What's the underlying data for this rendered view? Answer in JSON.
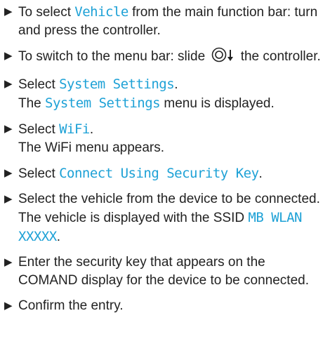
{
  "steps": [
    {
      "pre": "To select ",
      "term": "Vehicle",
      "post": " from the main function bar: turn and press the controller."
    },
    {
      "pre": "To switch to the menu bar: slide ",
      "post": " the controller."
    },
    {
      "pre": "Select ",
      "term": "System Settings",
      "post": ".",
      "line2_term": "The ",
      "line2_mono": "System Settings",
      "line2_post": " menu is displayed."
    },
    {
      "pre": "Select ",
      "term": "WiFi",
      "post": ".",
      "line2": "The WiFi menu appears."
    },
    {
      "pre": "Select ",
      "term": "Connect Using Security Key",
      "post": "."
    },
    {
      "pre": "Select the vehicle from the device to be connected. The vehicle is displayed with the SSID ",
      "term": "MB WLAN XXXXX",
      "post": "."
    },
    {
      "text": "Enter the security key that appears on the COMAND display for the device to be con­nected."
    },
    {
      "text": "Confirm the entry."
    }
  ],
  "bullet_glyph": "▶",
  "icons": {
    "controller": "controller-icon",
    "slide_down": "arrow-down-icon"
  },
  "colors": {
    "term": "#1da1d6",
    "text": "#222222"
  }
}
